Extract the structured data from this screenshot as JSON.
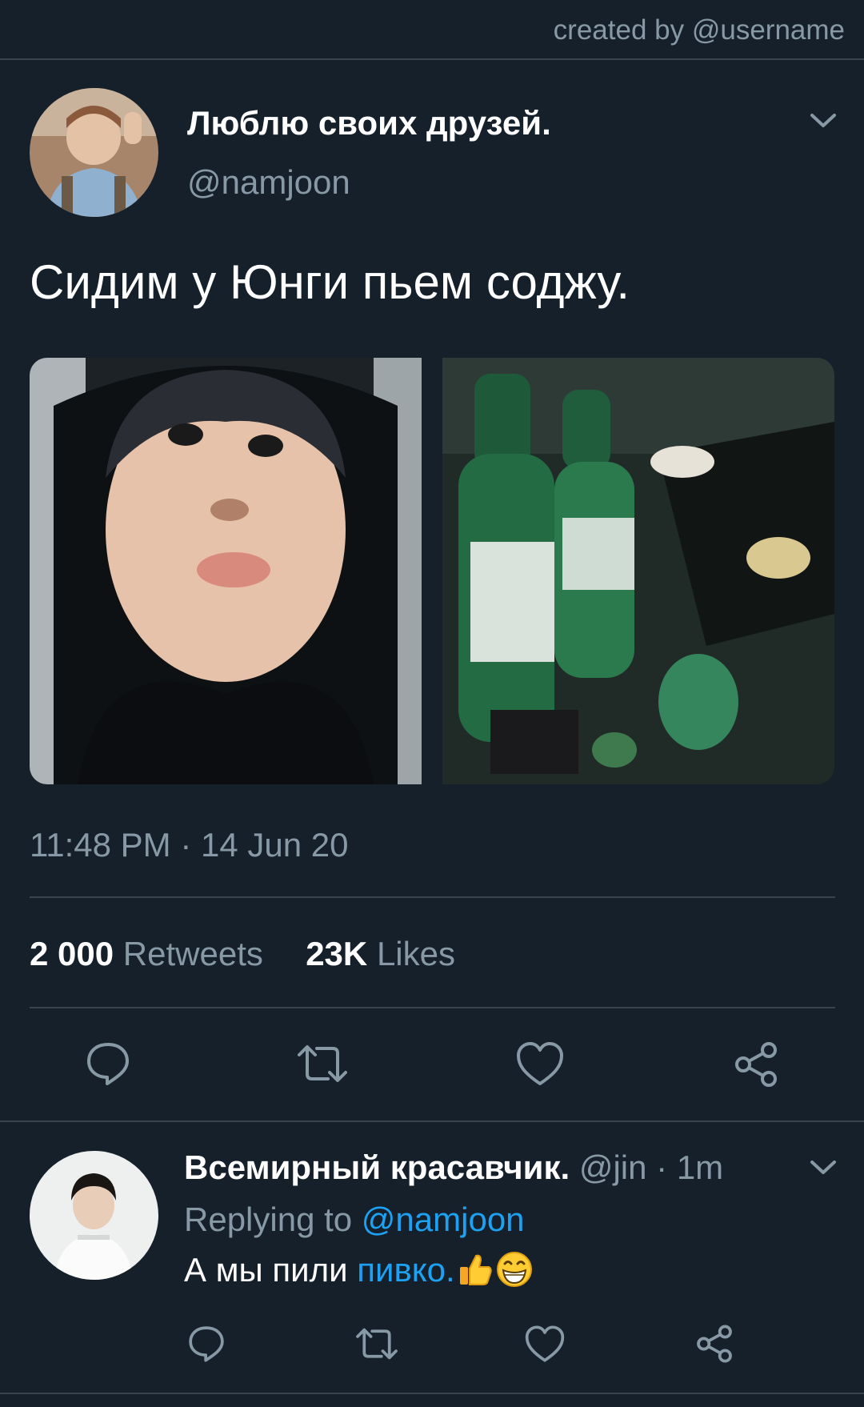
{
  "watermark": "created by @username",
  "tweet": {
    "display_name": "Люблю своих друзей.",
    "handle": "@namjoon",
    "text": "Сидим у Юнги пьем соджу.",
    "timestamp": "11:48 PM · 14 Jun 20",
    "retweets_count": "2 000",
    "retweets_label": "Retweets",
    "likes_count": "23K",
    "likes_label": "Likes"
  },
  "reply": {
    "display_name": "Всемирный красавчик.",
    "handle": "@jin",
    "dot": "·",
    "time": "1m",
    "replying_to_label": "Replying to",
    "replying_to_handle": "@namjoon",
    "text_plain": "А мы пили ",
    "text_highlight": "пивко.",
    "emojis": [
      "thumbs-up-icon",
      "grinning-face-icon"
    ]
  },
  "colors": {
    "background": "#15202b",
    "secondary_text": "#8899a6",
    "link": "#1da1f2",
    "divider": "#38444d"
  },
  "icons": [
    "chevron-down-icon",
    "reply-icon",
    "retweet-icon",
    "like-icon",
    "share-icon"
  ]
}
